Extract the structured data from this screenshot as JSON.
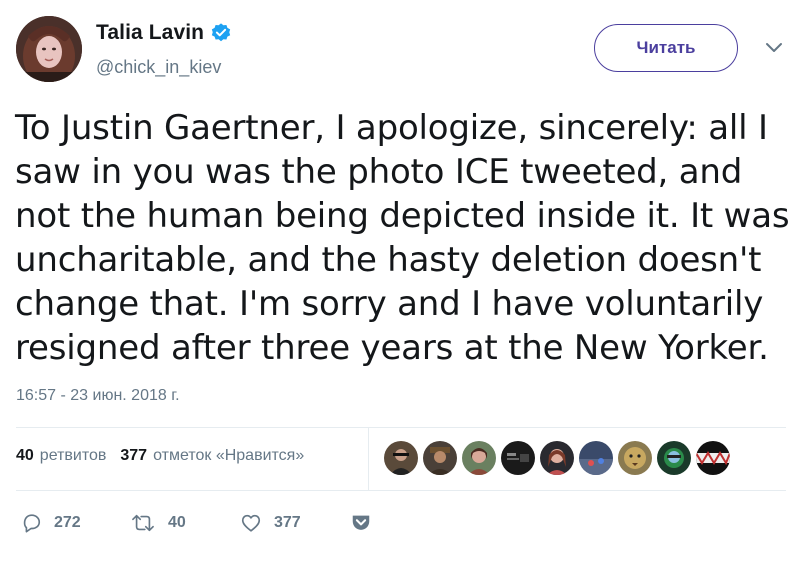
{
  "user": {
    "display_name": "Talia Lavin",
    "handle": "@chick_in_kiev",
    "verified": true
  },
  "header": {
    "follow_label": "Читать"
  },
  "tweet": {
    "lines": [
      "To Justin Gaertner, I apologize, sincerely: all I",
      "saw in you was the photo ICE tweeted, and",
      "not the human being depicted inside it. It was",
      "uncharitable, and the hasty deletion doesn't",
      "change that. I'm sorry and I have voluntarily",
      "resigned after three years at the New Yorker."
    ],
    "timestamp": "16:57 - 23 июн. 2018 г."
  },
  "stats": {
    "retweets_count": "40",
    "retweets_label": "ретвитов",
    "likes_count": "377",
    "likes_label": "отметок «Нравится»"
  },
  "actions": {
    "replies": "272",
    "retweets": "40",
    "likes": "377"
  },
  "colors": {
    "accent": "#4b3f9e",
    "verified": "#1da1f2",
    "muted": "#657786",
    "text": "#14171a"
  }
}
